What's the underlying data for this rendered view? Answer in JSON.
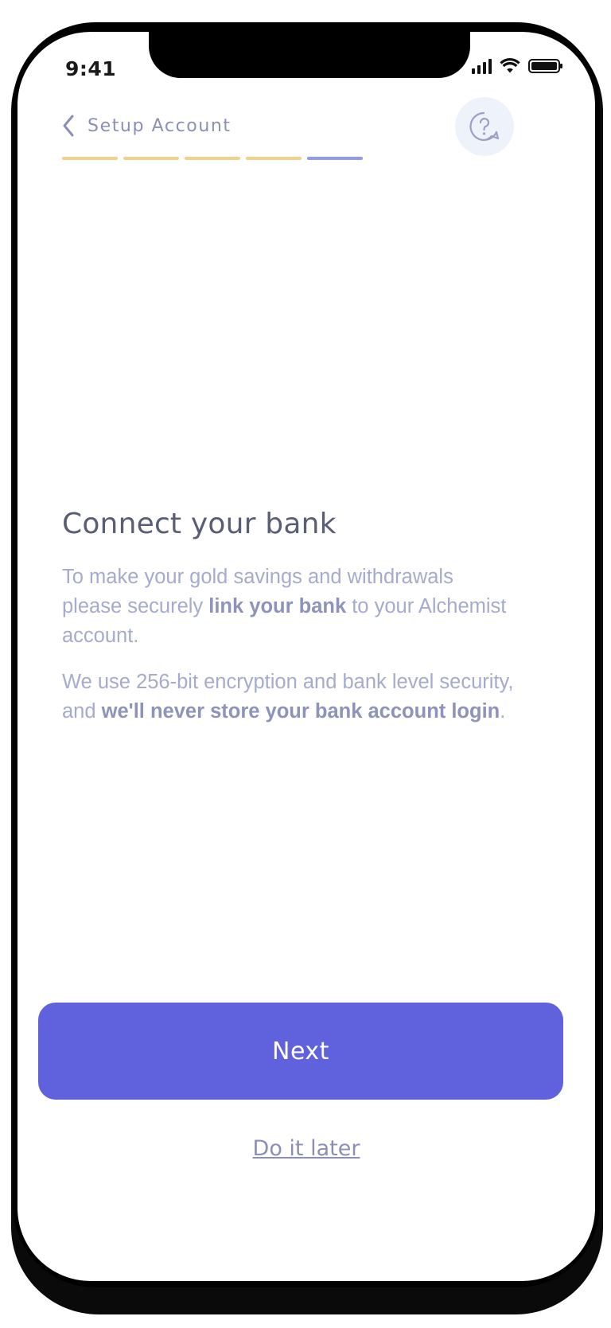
{
  "status_bar": {
    "time": "9:41"
  },
  "header": {
    "back_label": "Setup Account"
  },
  "progress": {
    "steps_total": 5,
    "current_step": 5,
    "completed_color": "#f2d08a",
    "active_color": "#8f9af0"
  },
  "main": {
    "title": "Connect your bank",
    "para1": {
      "t1": "To make your gold savings and withdrawals please securely ",
      "b1": "link your bank",
      "t2": " to your Alchemist account."
    },
    "para2": {
      "t1": "We use 256-bit encryption and bank level security, and ",
      "b1": "we'll never store your bank account login",
      "t2": "."
    }
  },
  "actions": {
    "next_label": "Next",
    "later_label": "Do it later"
  },
  "icons": {
    "back": "chevron-left-icon",
    "help": "help-question-icon",
    "signal": "cellular-signal-icon",
    "wifi": "wifi-icon",
    "battery": "battery-icon"
  },
  "colors": {
    "accent": "#5f62dc",
    "text_muted": "#a5abcc",
    "title": "#5a5e74"
  }
}
